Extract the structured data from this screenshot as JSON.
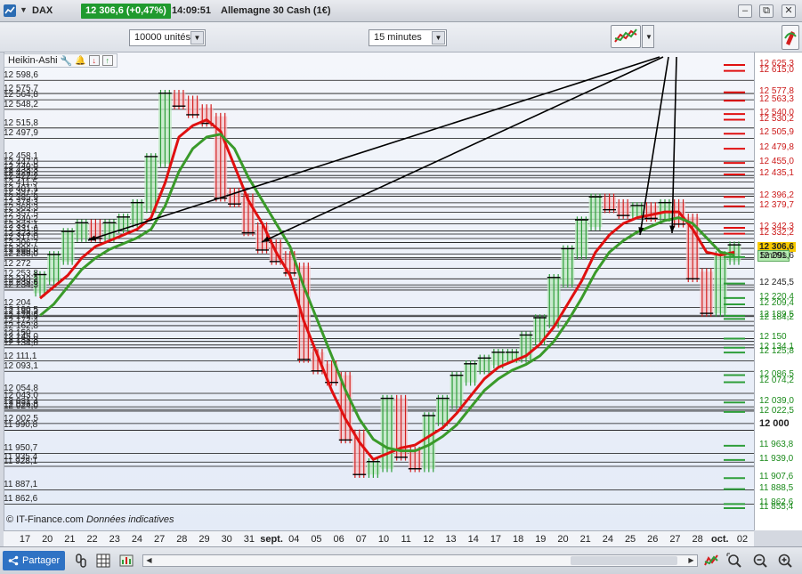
{
  "title_bar": {
    "symbol": "DAX",
    "price_change": "12 306,6 (+0,47%)",
    "time": "14:09:51",
    "instrument": "Allemagne 30 Cash (1€)"
  },
  "toolbar": {
    "quantity": "10000 unités",
    "timeframe": "15 minutes"
  },
  "indicator": {
    "label": "Heikin-Ashi"
  },
  "colors": {
    "up_candle": "#2e9e3a",
    "down_candle": "#d42020",
    "ma_red": "#e01010",
    "ma_green": "#3a9a2a",
    "price_badge": "#f7c900",
    "countdown_badge": "#b6ecb2"
  },
  "left_price_labels": [
    "12 598,6",
    "12 575,7",
    "12 564,8",
    "12 548,2",
    "12 515,8",
    "12 497,9",
    "12 458,1",
    "12 447,0",
    "12 440,0",
    "12 433,3",
    "12 429,2",
    "12 422,2",
    "12 411,5",
    "12 401,1",
    "12 397,2",
    "12 385,9",
    "12 378,3",
    "12 369,3",
    "12 357,5",
    "12 349,2",
    "12 337,1",
    "12 331,6",
    "12 323,8",
    "12 317,0",
    "12 306,7",
    "12 296,6",
    "12 290,8",
    "12 288,0",
    "12 272",
    "12 253,8",
    "12 243,2",
    "12 238,8",
    "12 234,3",
    "12 204",
    "12 190,5",
    "12 188,3",
    "12 179,9",
    "12 172,4",
    "12 162,8",
    "12 150",
    "12 145,0",
    "12 138,8",
    "12 134,0",
    "12 111,1",
    "12 093,1",
    "12 054,8",
    "12 043,0",
    "12 031,4",
    "12 026,8",
    "12 024,0",
    "12 002,5",
    "11 990,8",
    "11 950,7",
    "11 935,4",
    "11 928,1",
    "11 887,1",
    "11 862,6"
  ],
  "right_price_labels": [
    "12 625,3",
    "12 615,0",
    "12 577,8",
    "12 563,3",
    "12 540,0",
    "12 530,2",
    "12 505,9",
    "12 479,8",
    "12 455,0",
    "12 435,1",
    "12 396,2",
    "12 379,7",
    "12 342,3",
    "12 332,2",
    "12 306,6",
    "5m09s",
    "12 291,6",
    "12 245,5",
    "12 220,4",
    "12 209,4",
    "12 189,5",
    "12 184,2",
    "12 150",
    "12 134,1",
    "12 125,8",
    "12 086,5",
    "12 074,2",
    "12 039,0",
    "12 022,5",
    "12 000",
    "11 963,8",
    "11 939,0",
    "11 907,6",
    "11 888,5",
    "11 862,6",
    "11 855,4"
  ],
  "copyright": {
    "source": "© IT-Finance.com",
    "note": "Données indicatives"
  },
  "x_axis_labels": [
    "17",
    "20",
    "21",
    "22",
    "23",
    "24",
    "27",
    "28",
    "29",
    "30",
    "31",
    "sept.",
    "04",
    "05",
    "06",
    "07",
    "10",
    "11",
    "12",
    "13",
    "14",
    "17",
    "18",
    "19",
    "20",
    "21",
    "24",
    "25",
    "26",
    "27",
    "28",
    "oct.",
    "02"
  ],
  "bottom": {
    "share_label": "Partager"
  },
  "chart_data": {
    "type": "candlestick",
    "style": "heikin-ashi",
    "title": "",
    "timeframe": "15 minutes",
    "current_price": 12306.6,
    "countdown": "5m09s",
    "x_range": [
      "17",
      "02"
    ],
    "y_range": [
      11855.4,
      12625.3
    ],
    "close_series": [
      12255,
      12290,
      12330,
      12345,
      12330,
      12345,
      12355,
      12380,
      12460,
      12570,
      12560,
      12545,
      12530,
      12400,
      12390,
      12340,
      12310,
      12290,
      12270,
      12120,
      12100,
      12080,
      11980,
      11920,
      11930,
      12040,
      11950,
      11930,
      12010,
      12040,
      12080,
      12100,
      12110,
      12120,
      12120,
      12150,
      12180,
      12250,
      12300,
      12350,
      12390,
      12380,
      12370,
      12375,
      12365,
      12380,
      12355,
      12260,
      12200,
      12290,
      12306.6
    ],
    "ma_red": [
      12220,
      12240,
      12260,
      12290,
      12310,
      12320,
      12330,
      12340,
      12360,
      12420,
      12500,
      12520,
      12530,
      12510,
      12450,
      12390,
      12350,
      12300,
      12260,
      12180,
      12120,
      12060,
      12010,
      11970,
      11940,
      11950,
      11960,
      11965,
      11980,
      11995,
      12020,
      12050,
      12080,
      12100,
      12110,
      12120,
      12140,
      12170,
      12210,
      12250,
      12300,
      12330,
      12350,
      12360,
      12365,
      12370,
      12370,
      12340,
      12300,
      12295,
      12300
    ],
    "ma_green": [
      12190,
      12210,
      12240,
      12270,
      12290,
      12305,
      12315,
      12325,
      12340,
      12380,
      12440,
      12480,
      12500,
      12505,
      12480,
      12430,
      12390,
      12350,
      12310,
      12240,
      12180,
      12120,
      12060,
      12010,
      11975,
      11960,
      11955,
      11955,
      11965,
      11980,
      12000,
      12030,
      12060,
      12080,
      12095,
      12105,
      12120,
      12145,
      12180,
      12220,
      12265,
      12300,
      12320,
      12335,
      12345,
      12355,
      12360,
      12350,
      12325,
      12300,
      12295
    ]
  }
}
